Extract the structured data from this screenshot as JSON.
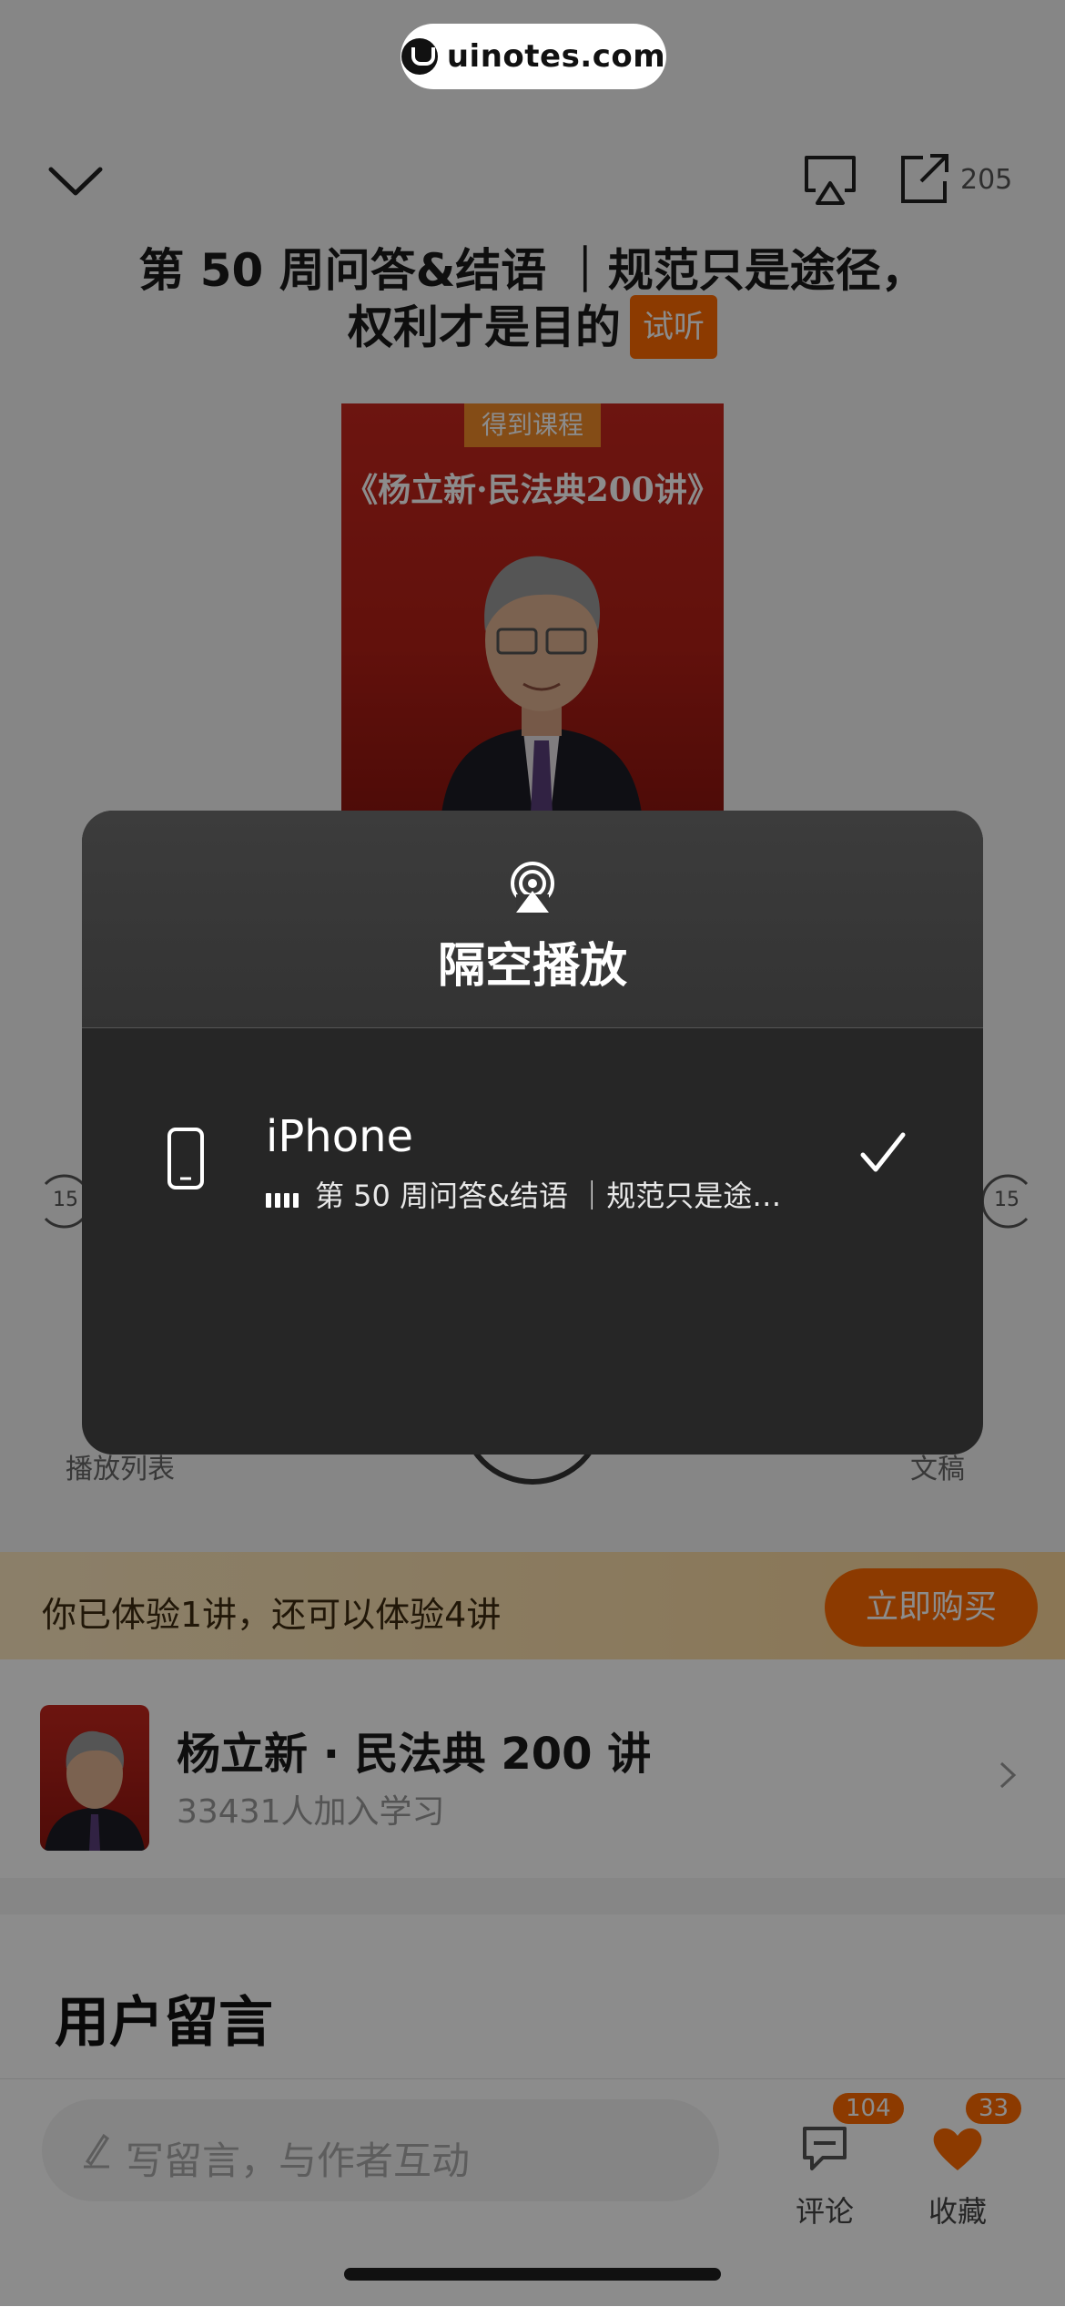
{
  "watermark": {
    "text": "uinotes.com"
  },
  "header": {
    "share_count": "205"
  },
  "lesson": {
    "title_line1": "第 50 周问答&结语 ｜规范只是途径，",
    "title_line2": "权利才是目的",
    "trial_badge": "试听"
  },
  "cover": {
    "tag": "得到课程",
    "title": "《杨立新·民法典200讲》"
  },
  "player": {
    "left_label": "播放列表",
    "right_label": "文稿",
    "rewind_value": "15",
    "forward_value": "15"
  },
  "trial_bar": {
    "text": "你已体验1讲，还可以体验4讲",
    "buy_label": "立即购买"
  },
  "course": {
    "name": "杨立新 · 民法典 200 讲",
    "learners": "33431人加入学习"
  },
  "comments_section": {
    "title": "用户留言"
  },
  "bottom_bar": {
    "input_placeholder": "写留言，与作者互动",
    "comment_label": "评论",
    "comment_count": "104",
    "favorite_label": "收藏",
    "favorite_count": "33"
  },
  "airplay_modal": {
    "title": "隔空播放",
    "device_name": "iPhone",
    "now_playing": "第 50 周问答&结语 ｜规范只是途…",
    "selected": true
  },
  "colors": {
    "accent": "#ff6b00",
    "modal_bg": "#262626"
  }
}
